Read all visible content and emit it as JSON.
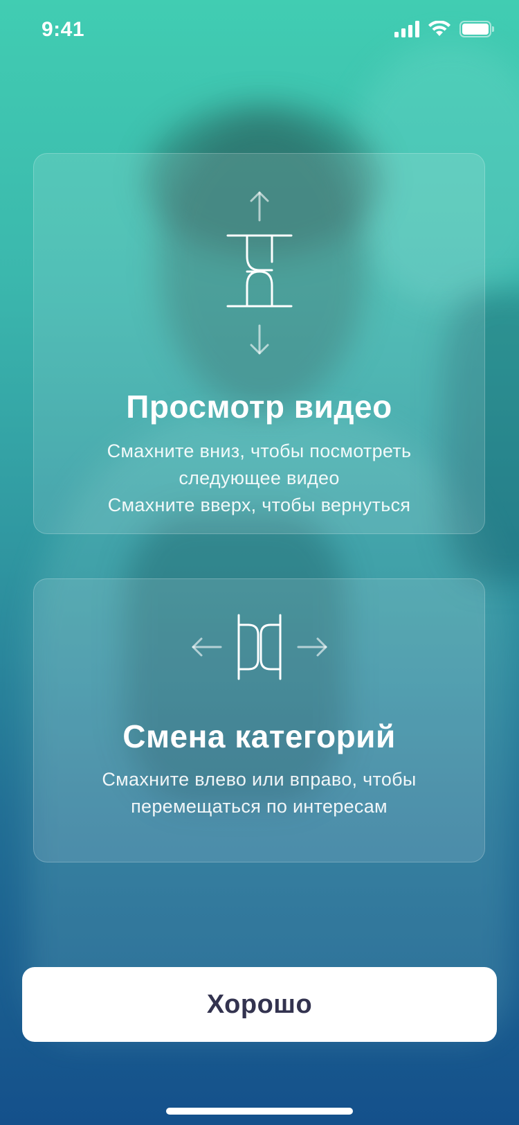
{
  "status_bar": {
    "time": "9:41",
    "icons": [
      "signal-icon",
      "wifi-icon",
      "battery-icon"
    ]
  },
  "cards": [
    {
      "icon": "swipe-vertical-icon",
      "title": "Просмотр видео",
      "lines": [
        "Смахните вниз, чтобы посмотреть",
        "следующее видео",
        "Смахните вверх, чтобы вернуться"
      ]
    },
    {
      "icon": "swipe-horizontal-icon",
      "title": "Смена категорий",
      "lines": [
        "Смахните влево или вправо, чтобы",
        "перемещаться по интересам"
      ]
    }
  ],
  "button": {
    "label": "Хорошо"
  },
  "colors": {
    "gradient_top": "#41cdb2",
    "gradient_bottom": "#14508b",
    "button_text": "#33334f"
  }
}
